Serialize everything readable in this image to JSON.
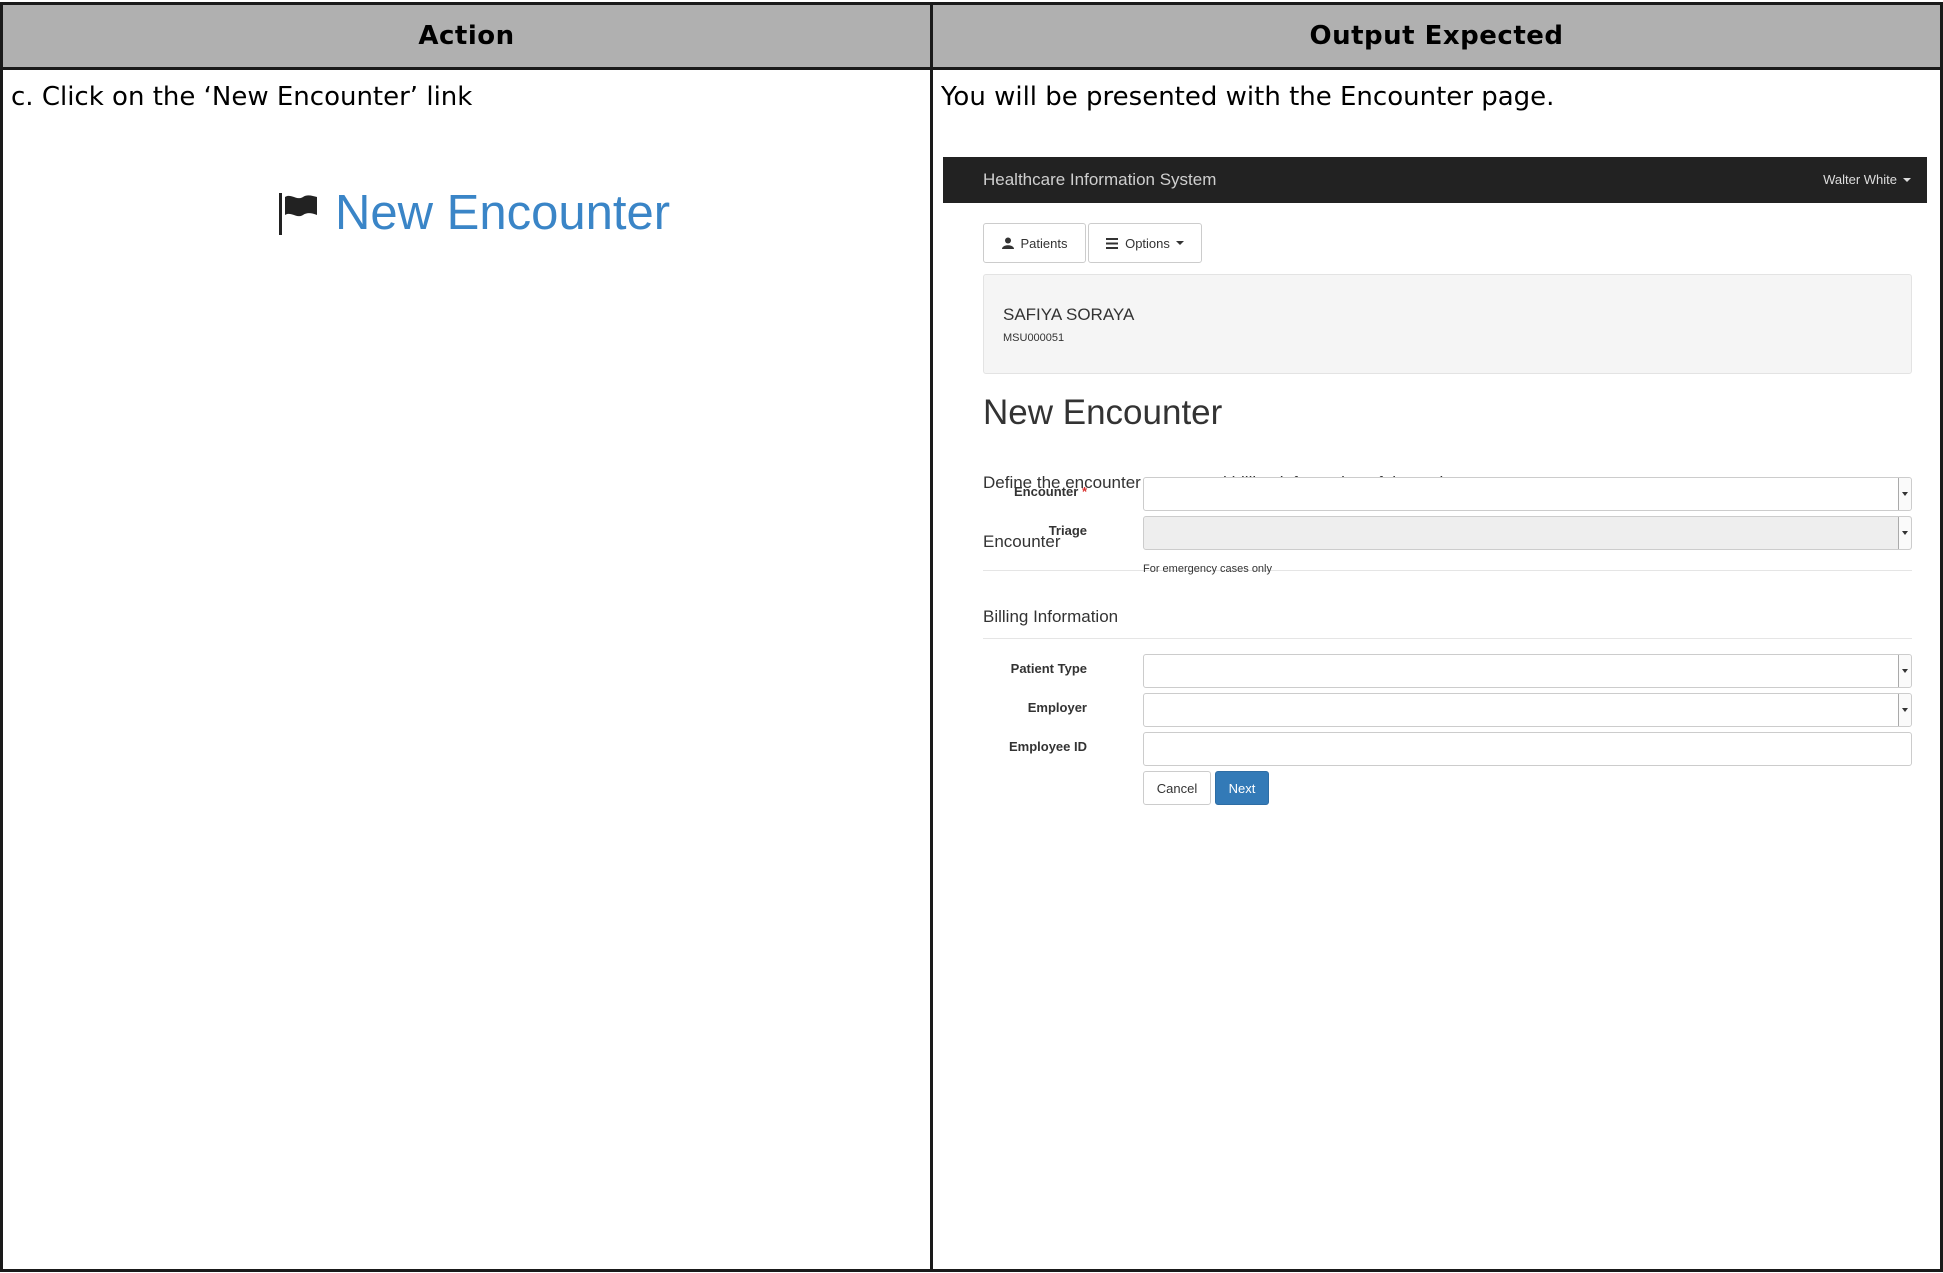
{
  "table": {
    "header_action": "Action",
    "header_output": "Output Expected",
    "action_text": "c. Click on the ‘New Encounter’ link",
    "action_link_label": "New Encounter",
    "output_text": "You will be presented with the Encounter page."
  },
  "app": {
    "brand": "Healthcare Information System",
    "user": "Walter White",
    "buttons": {
      "patients": "Patients",
      "options": "Options"
    },
    "patient": {
      "name": "SAFIYA SORAYA",
      "id": "MSU000051"
    },
    "title": "New Encounter",
    "subtitle": "Define the encounter nature and billing information of the patient",
    "sections": {
      "encounter": "Encounter",
      "billing": "Billing Information"
    },
    "fields": {
      "encounter_label": "Encounter",
      "required_mark": "*",
      "triage_label": "Triage",
      "triage_help": "For emergency cases only",
      "patient_type_label": "Patient Type",
      "employer_label": "Employer",
      "employee_id_label": "Employee ID"
    },
    "actions": {
      "cancel": "Cancel",
      "next": "Next"
    },
    "colors": {
      "navbar": "#222222",
      "primary": "#337ab7",
      "link": "#3a85c7"
    }
  }
}
